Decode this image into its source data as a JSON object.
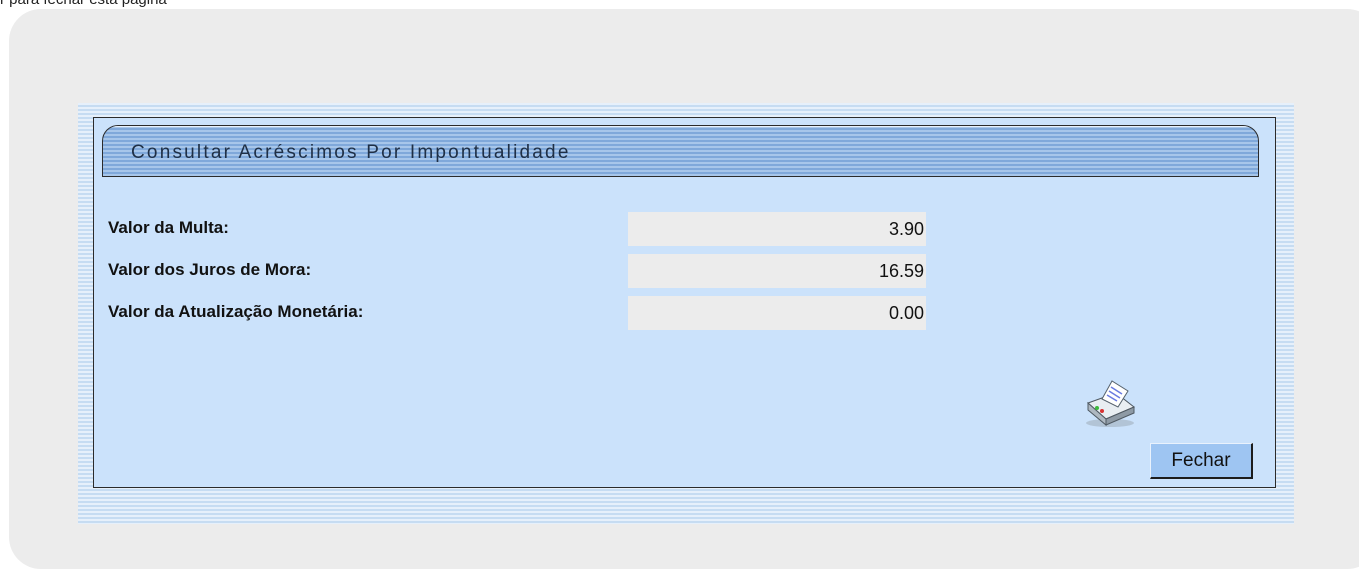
{
  "top_caption": "r para fechar esta página",
  "panel": {
    "title": "Consultar Acréscimos Por Impontualidade"
  },
  "fields": [
    {
      "label": "Valor da Multa:",
      "value": "3.90"
    },
    {
      "label": "Valor dos Juros de Mora:",
      "value": "16.59"
    },
    {
      "label": "Valor da Atualização Monetária:",
      "value": "0.00"
    }
  ],
  "actions": {
    "print_icon": "printer-icon",
    "close_label": "Fechar"
  },
  "colors": {
    "panel_bg": "#cbe2fb",
    "title_tab": "#7fa8da",
    "value_bg": "#ececec",
    "button_bg": "#9ec5f2"
  }
}
